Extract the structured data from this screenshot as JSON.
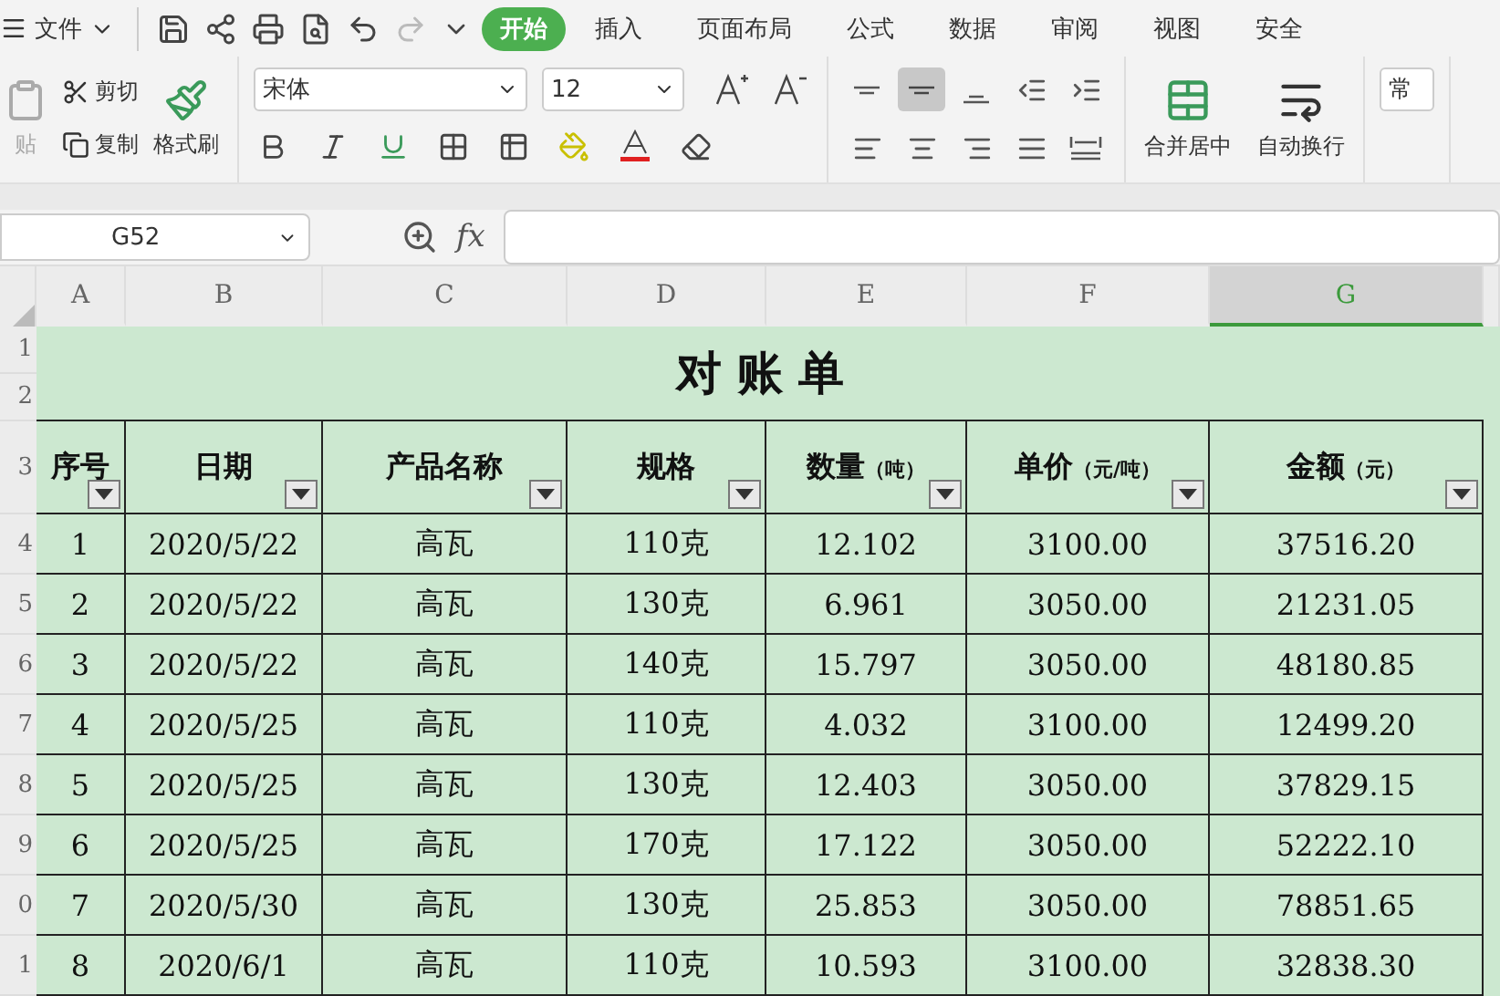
{
  "menu": {
    "label": "文件"
  },
  "tabs": [
    {
      "label": "开始",
      "selected": true
    },
    {
      "label": "插入",
      "selected": false
    },
    {
      "label": "页面布局",
      "selected": false
    },
    {
      "label": "公式",
      "selected": false
    },
    {
      "label": "数据",
      "selected": false
    },
    {
      "label": "审阅",
      "selected": false
    },
    {
      "label": "视图",
      "selected": false
    },
    {
      "label": "安全",
      "selected": false
    }
  ],
  "ribbon": {
    "paste": "贴",
    "cut": "剪切",
    "copy": "复制",
    "format_painter": "格式刷",
    "font": "宋体",
    "font_size": "12",
    "merge": "合并居中",
    "wrap": "自动换行",
    "number_format": "常",
    "align_top": [
      {
        "kind": "top",
        "selected": false
      },
      {
        "kind": "middle",
        "selected": true
      },
      {
        "kind": "bottom",
        "selected": false
      },
      {
        "kind": "outdent",
        "selected": false
      },
      {
        "kind": "indent",
        "selected": false
      }
    ],
    "align_bottom": [
      {
        "kind": "left",
        "selected": false
      },
      {
        "kind": "center",
        "selected": false
      },
      {
        "kind": "right",
        "selected": false
      },
      {
        "kind": "justify",
        "selected": false
      },
      {
        "kind": "distributed",
        "selected": false
      }
    ]
  },
  "name_box": "G52",
  "fx": "fx",
  "sheet": {
    "columns": [
      {
        "label": "A",
        "selected": false
      },
      {
        "label": "B",
        "selected": false
      },
      {
        "label": "C",
        "selected": false
      },
      {
        "label": "D",
        "selected": false
      },
      {
        "label": "E",
        "selected": false
      },
      {
        "label": "F",
        "selected": false
      },
      {
        "label": "G",
        "selected": true
      }
    ],
    "row_numbers": [
      "1",
      "2",
      "3",
      "4",
      "5",
      "6",
      "7",
      "8",
      "9",
      "0",
      "1"
    ],
    "title": "对 账 单",
    "headers": [
      {
        "label": "序号"
      },
      {
        "label": "日期"
      },
      {
        "label": "产品名称"
      },
      {
        "label": "规格"
      },
      {
        "label": "数量",
        "unit": "（吨）"
      },
      {
        "label": "单价",
        "unit": "（元/吨）"
      },
      {
        "label": "金额",
        "unit": "（元）"
      }
    ],
    "rows": [
      [
        "1",
        "2020/5/22",
        "高瓦",
        "110克",
        "12.102",
        "3100.00",
        "37516.20"
      ],
      [
        "2",
        "2020/5/22",
        "高瓦",
        "130克",
        "6.961",
        "3050.00",
        "21231.05"
      ],
      [
        "3",
        "2020/5/22",
        "高瓦",
        "140克",
        "15.797",
        "3050.00",
        "48180.85"
      ],
      [
        "4",
        "2020/5/25",
        "高瓦",
        "110克",
        "4.032",
        "3100.00",
        "12499.20"
      ],
      [
        "5",
        "2020/5/25",
        "高瓦",
        "130克",
        "12.403",
        "3050.00",
        "37829.15"
      ],
      [
        "6",
        "2020/5/25",
        "高瓦",
        "170克",
        "17.122",
        "3050.00",
        "52222.10"
      ],
      [
        "7",
        "2020/5/30",
        "高瓦",
        "130克",
        "25.853",
        "3050.00",
        "78851.65"
      ],
      [
        "8",
        "2020/6/1",
        "高瓦",
        "110克",
        "10.593",
        "3100.00",
        "32838.30"
      ]
    ]
  }
}
